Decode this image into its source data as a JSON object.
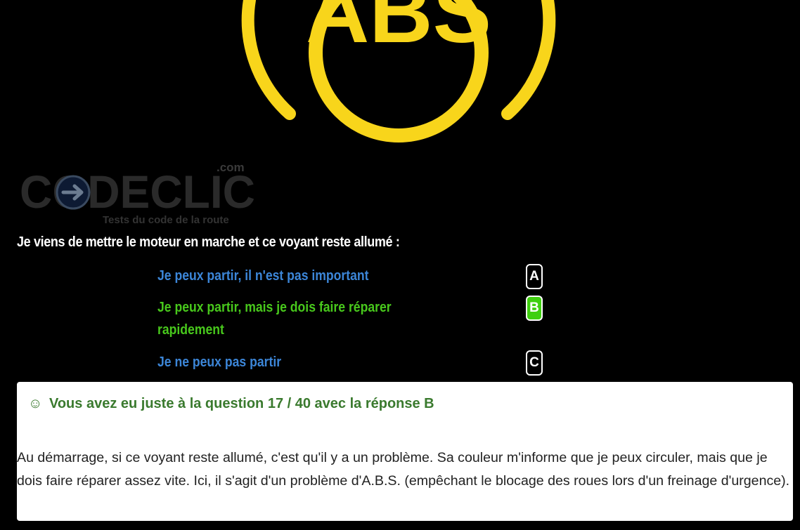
{
  "illustration": {
    "warning_light_text": "ABS",
    "warning_light_color": "#f8d51b",
    "icon": "abs-warning-light-icon"
  },
  "logo": {
    "brand": "CODECLIC",
    "domain": ".com",
    "tagline": "Tests du code de la route",
    "icon": "arrow-right-circle-icon"
  },
  "question": {
    "text": "Je viens de mettre le moteur en marche et ce voyant reste allumé :"
  },
  "answers": [
    {
      "key": "A",
      "text": "Je peux partir, il n'est pas important",
      "color": "#3c86d8"
    },
    {
      "key": "B",
      "text": "Je peux partir, mais je dois faire réparer rapidement",
      "color": "#48c81c",
      "selected": true
    },
    {
      "key": "C",
      "text": "Je ne peux pas partir",
      "color": "#3c86d8"
    }
  ],
  "result": {
    "smiley": "☺",
    "message": "Vous avez eu juste à la question 17 / 40 avec la réponse B",
    "explanation": "Au démarrage, si ce voyant reste allumé, c'est qu'il y a un problème. Sa couleur m'informe que je peux circuler, mais que je dois faire réparer assez vite. Ici, il s'agit d'un problème d'A.B.S. (empêchant le blocage des roues lors d'un freinage d'urgence).",
    "color": "#3a7a2e"
  }
}
